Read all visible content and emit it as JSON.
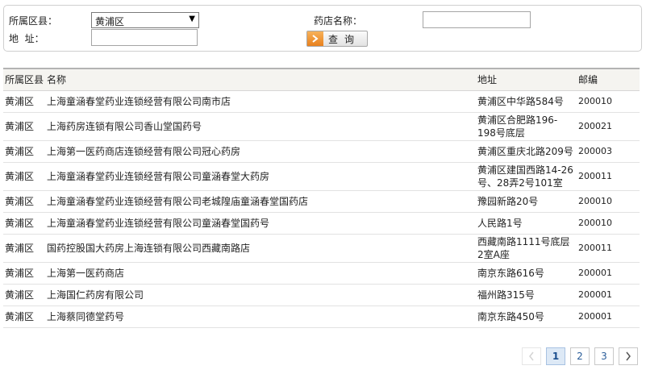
{
  "filters": {
    "district_label": "所属区县：",
    "district_value": "黄浦区",
    "address_label": "地  址：",
    "address_value": "",
    "store_name_label": "药店名称：",
    "store_name_value": "",
    "query_button": "查询"
  },
  "table": {
    "headers": {
      "district": "所属区县",
      "name": "名称",
      "address": "地址",
      "zip": "邮编"
    },
    "rows": [
      {
        "district": "黄浦区",
        "name": "上海童涵春堂药业连锁经营有限公司南市店",
        "address": "黄浦区中华路584号",
        "zip": "200010"
      },
      {
        "district": "黄浦区",
        "name": "上海药房连锁有限公司香山堂国药号",
        "address": "黄浦区合肥路196-198号底层",
        "zip": "200021"
      },
      {
        "district": "黄浦区",
        "name": "上海第一医药商店连锁经营有限公司冠心药房",
        "address": "黄浦区重庆北路209号",
        "zip": "200003"
      },
      {
        "district": "黄浦区",
        "name": "上海童涵春堂药业连锁经营有限公司童涵春堂大药房",
        "address": "黄浦区建国西路14-26号、28弄2号101室",
        "zip": "200011"
      },
      {
        "district": "黄浦区",
        "name": "上海童涵春堂药业连锁经营有限公司老城隍庙童涵春堂国药店",
        "address": "豫园新路20号",
        "zip": "200010"
      },
      {
        "district": "黄浦区",
        "name": "上海童涵春堂药业连锁经营有限公司童涵春堂国药号",
        "address": "人民路1号",
        "zip": "200010"
      },
      {
        "district": "黄浦区",
        "name": "国药控股国大药房上海连锁有限公司西藏南路店",
        "address": "西藏南路1111号底层2室A座",
        "zip": "200011"
      },
      {
        "district": "黄浦区",
        "name": "上海第一医药商店",
        "address": "南京东路616号",
        "zip": "200001"
      },
      {
        "district": "黄浦区",
        "name": "上海国仁药房有限公司",
        "address": "福州路315号",
        "zip": "200001"
      },
      {
        "district": "黄浦区",
        "name": "上海蔡同德堂药号",
        "address": "南京东路450号",
        "zip": "200001"
      }
    ]
  },
  "pagination": {
    "prev_icon": "chevron-left-icon",
    "next_icon": "chevron-right-icon",
    "pages": [
      "1",
      "2",
      "3"
    ],
    "current": "1"
  }
}
